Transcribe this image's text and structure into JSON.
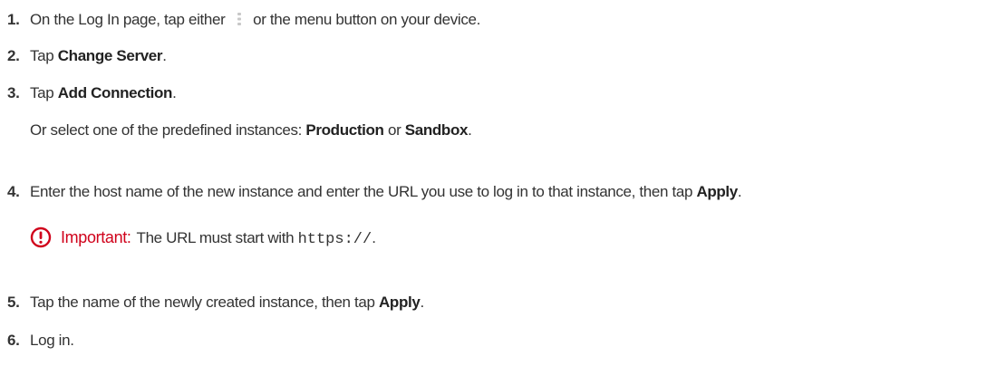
{
  "steps": [
    {
      "number": "1.",
      "before_icon": "On the Log In page, tap either ",
      "icon": "overflow-menu-icon",
      "after_icon": " or the menu button on your device."
    },
    {
      "number": "2.",
      "text": "Tap ",
      "bold": "Change Server",
      "end": "."
    },
    {
      "number": "3.",
      "text": "Tap ",
      "bold": "Add Connection",
      "end": ".",
      "sub": {
        "text": "Or select one of the predefined instances: ",
        "bold1": "Production",
        "mid": " or ",
        "bold2": "Sandbox",
        "end": "."
      }
    },
    {
      "number": "4.",
      "text": "Enter the host name of the new instance and enter the URL you use to log in to that instance, then tap ",
      "bold": "Apply",
      "end": ".",
      "note": {
        "icon": "important-icon",
        "label": "Important:",
        "text": "The URL must start with ",
        "code": "https://",
        "end": "."
      }
    },
    {
      "number": "5.",
      "text": "Tap the name of the newly created instance, then tap ",
      "bold": "Apply",
      "end": "."
    },
    {
      "number": "6.",
      "text": "Log in."
    }
  ],
  "colors": {
    "text": "#333333",
    "important": "#d0021b"
  }
}
